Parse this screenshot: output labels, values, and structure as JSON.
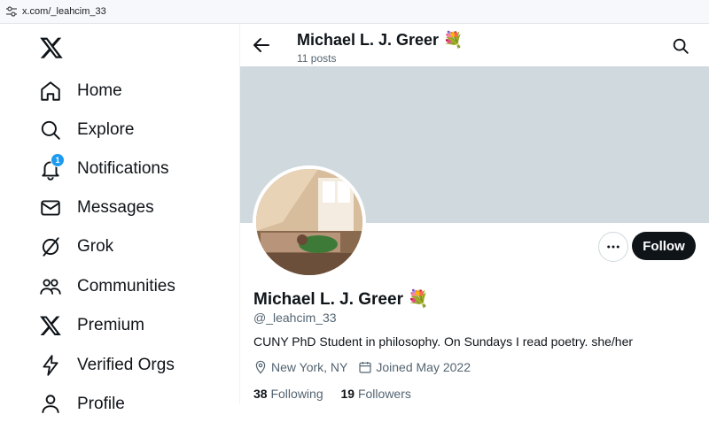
{
  "browser": {
    "url": "x.com/_leahcim_33"
  },
  "sidebar": {
    "logo": "x-logo-icon",
    "items": [
      {
        "label": "Home",
        "icon": "home-icon"
      },
      {
        "label": "Explore",
        "icon": "search-icon"
      },
      {
        "label": "Notifications",
        "icon": "bell-icon",
        "badge": "1"
      },
      {
        "label": "Messages",
        "icon": "mail-icon"
      },
      {
        "label": "Grok",
        "icon": "grok-icon"
      },
      {
        "label": "Communities",
        "icon": "people-icon"
      },
      {
        "label": "Premium",
        "icon": "x-logo-icon"
      },
      {
        "label": "Verified Orgs",
        "icon": "lightning-icon"
      },
      {
        "label": "Profile",
        "icon": "person-icon"
      }
    ]
  },
  "header": {
    "name": "Michael L. J. Greer",
    "emoji": "💐",
    "posts": "11 posts"
  },
  "profile": {
    "name": "Michael L. J. Greer",
    "emoji": "💐",
    "handle": "@_leahcim_33",
    "bio": "CUNY PhD Student in philosophy. On Sundays I read poetry. she/her",
    "location": "New York, NY",
    "joined": "Joined May 2022",
    "following_count": "38",
    "following_label": "Following",
    "followers_count": "19",
    "followers_label": "Followers",
    "follow_button": "Follow"
  },
  "colors": {
    "accent": "#1d9bf0",
    "banner": "#cfd9de",
    "text": "#0f1419",
    "muted": "#536471"
  }
}
